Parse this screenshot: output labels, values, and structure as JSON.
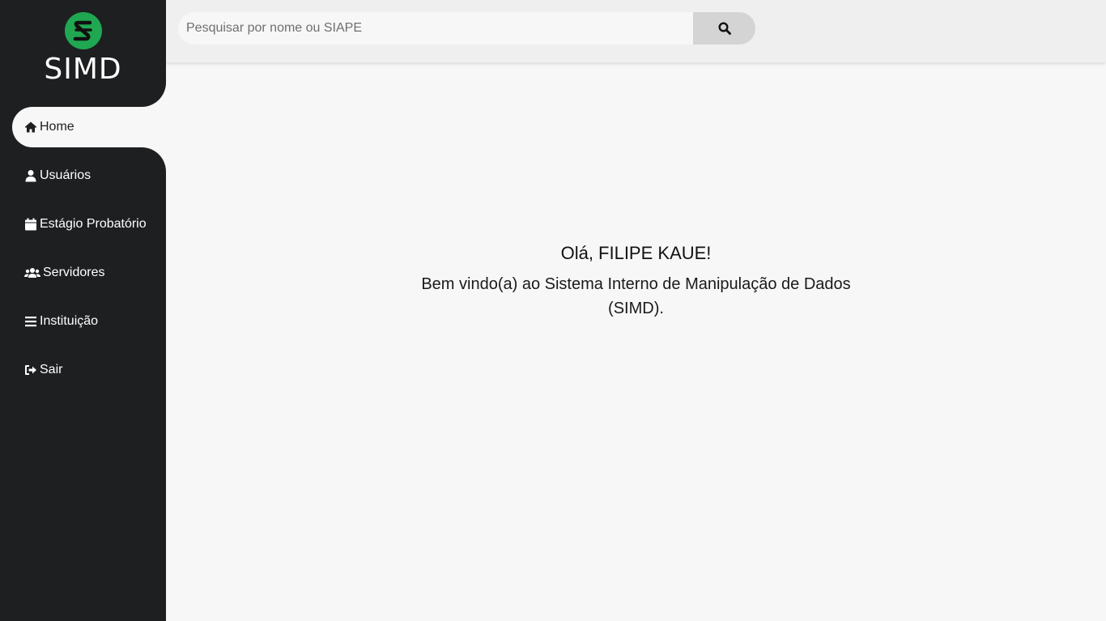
{
  "app": {
    "name": "SIMD",
    "logo_color": "#1fa851"
  },
  "sidebar": {
    "items": [
      {
        "label": "Home",
        "icon": "home-icon",
        "active": true
      },
      {
        "label": "Usuários",
        "icon": "user-icon",
        "active": false
      },
      {
        "label": "Estágio Probatório",
        "icon": "calendar-icon",
        "active": false
      },
      {
        "label": "Servidores",
        "icon": "users-icon",
        "active": false
      },
      {
        "label": "Instituição",
        "icon": "bars-icon",
        "active": false
      },
      {
        "label": "Sair",
        "icon": "sign-out-icon",
        "active": false
      }
    ]
  },
  "search": {
    "placeholder": "Pesquisar por nome ou SIAPE",
    "value": "",
    "button_icon": "search-icon"
  },
  "main": {
    "greeting": "Olá, FILIPE KAUE!",
    "welcome_text": "Bem vindo(a) ao Sistema Interno de Manipulação de Dados (SIMD)."
  },
  "colors": {
    "sidebar_bg": "#1e1f21",
    "content_bg": "#f7f7f7",
    "topbar_bg": "#efefef",
    "search_button_bg": "#d4d4d4"
  }
}
